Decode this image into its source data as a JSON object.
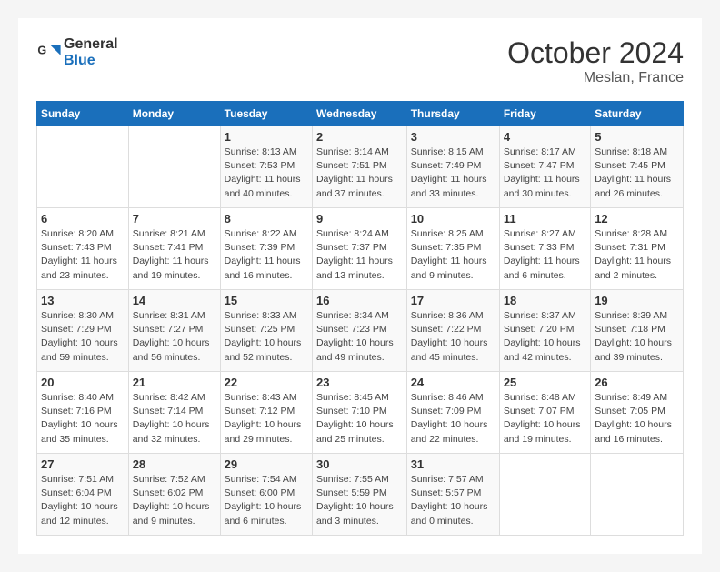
{
  "header": {
    "logo_line1": "General",
    "logo_line2": "Blue",
    "month_title": "October 2024",
    "location": "Meslan, France"
  },
  "days_of_week": [
    "Sunday",
    "Monday",
    "Tuesday",
    "Wednesday",
    "Thursday",
    "Friday",
    "Saturday"
  ],
  "weeks": [
    [
      {
        "num": "",
        "info": ""
      },
      {
        "num": "",
        "info": ""
      },
      {
        "num": "1",
        "info": "Sunrise: 8:13 AM\nSunset: 7:53 PM\nDaylight: 11 hours\nand 40 minutes."
      },
      {
        "num": "2",
        "info": "Sunrise: 8:14 AM\nSunset: 7:51 PM\nDaylight: 11 hours\nand 37 minutes."
      },
      {
        "num": "3",
        "info": "Sunrise: 8:15 AM\nSunset: 7:49 PM\nDaylight: 11 hours\nand 33 minutes."
      },
      {
        "num": "4",
        "info": "Sunrise: 8:17 AM\nSunset: 7:47 PM\nDaylight: 11 hours\nand 30 minutes."
      },
      {
        "num": "5",
        "info": "Sunrise: 8:18 AM\nSunset: 7:45 PM\nDaylight: 11 hours\nand 26 minutes."
      }
    ],
    [
      {
        "num": "6",
        "info": "Sunrise: 8:20 AM\nSunset: 7:43 PM\nDaylight: 11 hours\nand 23 minutes."
      },
      {
        "num": "7",
        "info": "Sunrise: 8:21 AM\nSunset: 7:41 PM\nDaylight: 11 hours\nand 19 minutes."
      },
      {
        "num": "8",
        "info": "Sunrise: 8:22 AM\nSunset: 7:39 PM\nDaylight: 11 hours\nand 16 minutes."
      },
      {
        "num": "9",
        "info": "Sunrise: 8:24 AM\nSunset: 7:37 PM\nDaylight: 11 hours\nand 13 minutes."
      },
      {
        "num": "10",
        "info": "Sunrise: 8:25 AM\nSunset: 7:35 PM\nDaylight: 11 hours\nand 9 minutes."
      },
      {
        "num": "11",
        "info": "Sunrise: 8:27 AM\nSunset: 7:33 PM\nDaylight: 11 hours\nand 6 minutes."
      },
      {
        "num": "12",
        "info": "Sunrise: 8:28 AM\nSunset: 7:31 PM\nDaylight: 11 hours\nand 2 minutes."
      }
    ],
    [
      {
        "num": "13",
        "info": "Sunrise: 8:30 AM\nSunset: 7:29 PM\nDaylight: 10 hours\nand 59 minutes."
      },
      {
        "num": "14",
        "info": "Sunrise: 8:31 AM\nSunset: 7:27 PM\nDaylight: 10 hours\nand 56 minutes."
      },
      {
        "num": "15",
        "info": "Sunrise: 8:33 AM\nSunset: 7:25 PM\nDaylight: 10 hours\nand 52 minutes."
      },
      {
        "num": "16",
        "info": "Sunrise: 8:34 AM\nSunset: 7:23 PM\nDaylight: 10 hours\nand 49 minutes."
      },
      {
        "num": "17",
        "info": "Sunrise: 8:36 AM\nSunset: 7:22 PM\nDaylight: 10 hours\nand 45 minutes."
      },
      {
        "num": "18",
        "info": "Sunrise: 8:37 AM\nSunset: 7:20 PM\nDaylight: 10 hours\nand 42 minutes."
      },
      {
        "num": "19",
        "info": "Sunrise: 8:39 AM\nSunset: 7:18 PM\nDaylight: 10 hours\nand 39 minutes."
      }
    ],
    [
      {
        "num": "20",
        "info": "Sunrise: 8:40 AM\nSunset: 7:16 PM\nDaylight: 10 hours\nand 35 minutes."
      },
      {
        "num": "21",
        "info": "Sunrise: 8:42 AM\nSunset: 7:14 PM\nDaylight: 10 hours\nand 32 minutes."
      },
      {
        "num": "22",
        "info": "Sunrise: 8:43 AM\nSunset: 7:12 PM\nDaylight: 10 hours\nand 29 minutes."
      },
      {
        "num": "23",
        "info": "Sunrise: 8:45 AM\nSunset: 7:10 PM\nDaylight: 10 hours\nand 25 minutes."
      },
      {
        "num": "24",
        "info": "Sunrise: 8:46 AM\nSunset: 7:09 PM\nDaylight: 10 hours\nand 22 minutes."
      },
      {
        "num": "25",
        "info": "Sunrise: 8:48 AM\nSunset: 7:07 PM\nDaylight: 10 hours\nand 19 minutes."
      },
      {
        "num": "26",
        "info": "Sunrise: 8:49 AM\nSunset: 7:05 PM\nDaylight: 10 hours\nand 16 minutes."
      }
    ],
    [
      {
        "num": "27",
        "info": "Sunrise: 7:51 AM\nSunset: 6:04 PM\nDaylight: 10 hours\nand 12 minutes."
      },
      {
        "num": "28",
        "info": "Sunrise: 7:52 AM\nSunset: 6:02 PM\nDaylight: 10 hours\nand 9 minutes."
      },
      {
        "num": "29",
        "info": "Sunrise: 7:54 AM\nSunset: 6:00 PM\nDaylight: 10 hours\nand 6 minutes."
      },
      {
        "num": "30",
        "info": "Sunrise: 7:55 AM\nSunset: 5:59 PM\nDaylight: 10 hours\nand 3 minutes."
      },
      {
        "num": "31",
        "info": "Sunrise: 7:57 AM\nSunset: 5:57 PM\nDaylight: 10 hours\nand 0 minutes."
      },
      {
        "num": "",
        "info": ""
      },
      {
        "num": "",
        "info": ""
      }
    ]
  ]
}
